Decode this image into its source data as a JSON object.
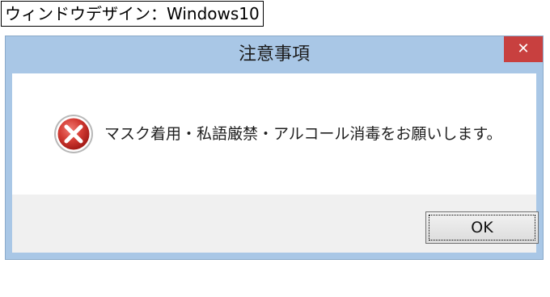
{
  "caption": {
    "label": "ウィンドウデザイン：Windows10"
  },
  "dialog": {
    "title": "注意事項",
    "close_glyph": "✕",
    "message": "マスク着用・私語厳禁・アルコール消毒をお願いします。",
    "icon": "error-x-icon",
    "ok_label": "OK"
  },
  "colors": {
    "titlebar": "#a9c7e6",
    "close_button": "#c8403f",
    "content_bg": "#ffffff",
    "footer_bg": "#f0f0f0",
    "error_icon": "#c9302c"
  }
}
